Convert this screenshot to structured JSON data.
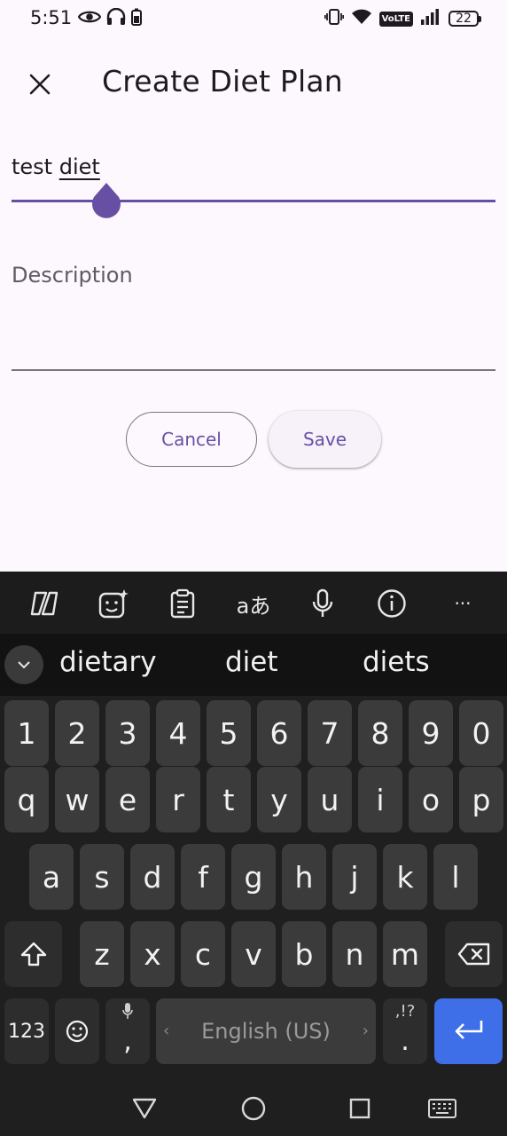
{
  "status_bar": {
    "time": "5:51",
    "battery": "22",
    "network_badge": "VoLTE"
  },
  "header": {
    "title": "Create Diet Plan",
    "close_icon": "close-icon"
  },
  "form": {
    "name_value_word1": "test",
    "name_value_word2": "diet",
    "description_placeholder": "Description"
  },
  "actions": {
    "cancel_label": "Cancel",
    "save_label": "Save"
  },
  "colors": {
    "primary": "#6750a4",
    "surface": "#fdf7fe",
    "keyboard_bg": "#1f1f1f",
    "enter_key": "#3f6fe8"
  },
  "keyboard": {
    "toolbar_icons": [
      "copilot-icon",
      "sticker-icon",
      "clipboard-icon",
      "translate-icon",
      "microphone-icon",
      "info-icon",
      "more-icon"
    ],
    "translate_glyph": "aあ",
    "more_glyph": "···",
    "suggestions": [
      "dietary",
      "diet",
      "diets"
    ],
    "row_numbers": [
      "1",
      "2",
      "3",
      "4",
      "5",
      "6",
      "7",
      "8",
      "9",
      "0"
    ],
    "row_1": [
      "q",
      "w",
      "e",
      "r",
      "t",
      "y",
      "u",
      "i",
      "o",
      "p"
    ],
    "row_2": [
      "a",
      "s",
      "d",
      "f",
      "g",
      "h",
      "j",
      "k",
      "l"
    ],
    "row_3": [
      "z",
      "x",
      "c",
      "v",
      "b",
      "n",
      "m"
    ],
    "symbols_key": "123",
    "comma_key": ",",
    "space_label": "English (US)",
    "space_left": "‹",
    "space_right": "›",
    "period_key": ".",
    "period_sub": ",!?"
  }
}
